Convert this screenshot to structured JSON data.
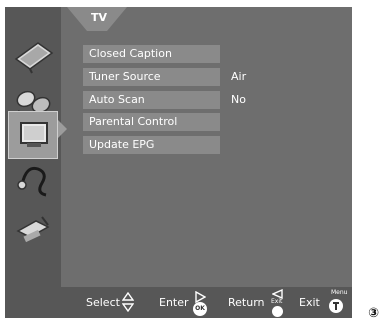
{
  "menu": {
    "title": "TV",
    "items": [
      {
        "label": "Closed Caption",
        "value": ""
      },
      {
        "label": "Tuner Source",
        "value": "Air"
      },
      {
        "label": "Auto Scan",
        "value": "No"
      },
      {
        "label": "Parental Control",
        "value": ""
      },
      {
        "label": "Update EPG",
        "value": ""
      }
    ]
  },
  "sidebar": {
    "items": [
      {
        "icon": "picture-icon",
        "selected": false
      },
      {
        "icon": "sound-icon",
        "selected": false
      },
      {
        "icon": "tv-icon",
        "selected": true
      },
      {
        "icon": "setup-cable-icon",
        "selected": false
      },
      {
        "icon": "tools-icon",
        "selected": false
      }
    ]
  },
  "footer": {
    "select_label": "Select",
    "enter_label": "Enter",
    "enter_button_text": "OK",
    "return_label": "Return",
    "return_button_text": "Exit",
    "exit_label": "Exit",
    "exit_button_text": "Menu"
  },
  "badge": "③"
}
